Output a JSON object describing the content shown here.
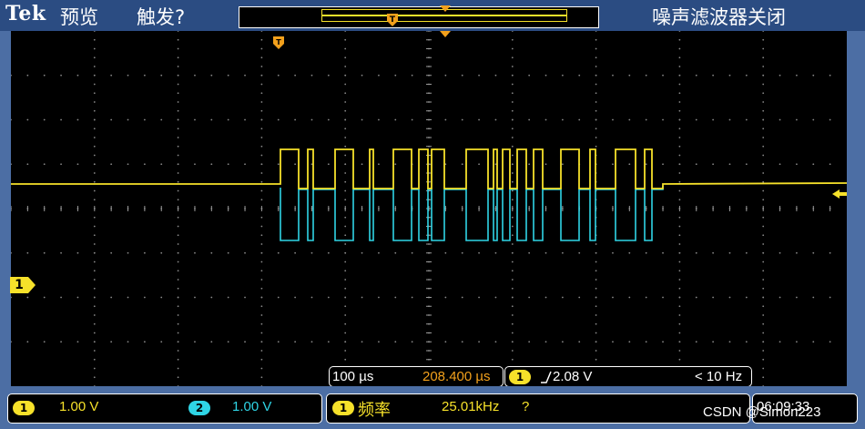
{
  "header": {
    "brand": "Tek",
    "mode": "预览",
    "trigger_status": "触发?",
    "noise_filter": "噪声滤波器关闭"
  },
  "markers": {
    "ch1_label": "1",
    "trigger_position_icon": "T",
    "trigger_level_icon": "trigger-level-arrow"
  },
  "timebase": {
    "scale": "100 µs",
    "position": "208.400 µs",
    "trigger_channel": "1",
    "trigger_slope": "rising-edge",
    "trigger_level": "2.08 V",
    "trigger_freq": "< 10 Hz"
  },
  "channels": [
    {
      "id": "1",
      "scale": "1.00 V",
      "color": "#f6e12a"
    },
    {
      "id": "2",
      "scale": "1.00 V",
      "color": "#2fd5e6"
    }
  ],
  "measurement": {
    "channel": "1",
    "name": "频率",
    "value": "25.01kHz",
    "flag": "?"
  },
  "clock": "06:09:33",
  "watermark": "CSDN @Simon223",
  "colors": {
    "ch1": "#f6e12a",
    "ch2": "#2fd5e6",
    "bezel": "#4c6ea4",
    "accent": "#f2a01c"
  }
}
